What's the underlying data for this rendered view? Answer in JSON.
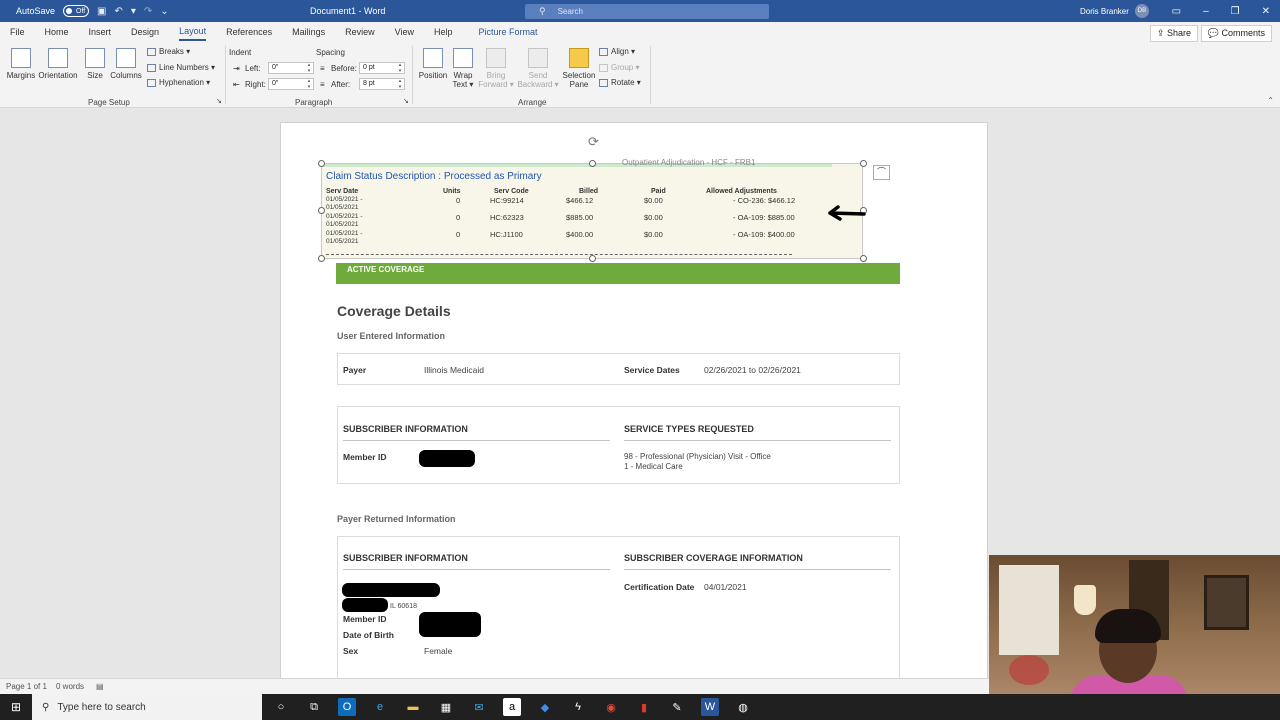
{
  "titlebar": {
    "autosave_label": "AutoSave",
    "autosave_state": "Off",
    "doc_title": "Document1 - Word",
    "search_placeholder": "Search",
    "user_name": "Doris Branker",
    "user_initials": "DB"
  },
  "tabs": [
    "File",
    "Home",
    "Insert",
    "Design",
    "Layout",
    "References",
    "Mailings",
    "Review",
    "View",
    "Help"
  ],
  "active_tab": "Layout",
  "contextual_tab": "Picture Format",
  "share_label": "Share",
  "comments_label": "Comments",
  "ribbon": {
    "page_setup": {
      "margins": "Margins",
      "orientation": "Orientation",
      "size": "Size",
      "columns": "Columns",
      "breaks": "Breaks",
      "line_numbers": "Line Numbers",
      "hyphenation": "Hyphenation",
      "group_label": "Page Setup"
    },
    "paragraph": {
      "indent_label": "Indent",
      "left_label": "Left:",
      "left_value": "0\"",
      "right_label": "Right:",
      "right_value": "0\"",
      "spacing_label": "Spacing",
      "before_label": "Before:",
      "before_value": "0 pt",
      "after_label": "After:",
      "after_value": "8 pt",
      "group_label": "Paragraph"
    },
    "arrange": {
      "position": "Position",
      "wrap_text_1": "Wrap",
      "wrap_text_2": "Text",
      "bring_forward_1": "Bring",
      "bring_forward_2": "Forward",
      "send_backward_1": "Send",
      "send_backward_2": "Backward",
      "selection_pane_1": "Selection",
      "selection_pane_2": "Pane",
      "align": "Align",
      "group": "Group",
      "rotate": "Rotate",
      "group_label": "Arrange"
    }
  },
  "claim_image": {
    "cut_text": "Outpatient Adjudication - HCF - FRB1",
    "title": "Claim Status Description : Processed as Primary",
    "headers": [
      "Serv Date",
      "Units",
      "Serv Code",
      "Billed",
      "Paid",
      "Allowed Adjustments"
    ],
    "rows": [
      {
        "date1": "01/05/2021 -",
        "date2": "01/05/2021",
        "units": "0",
        "code": "HC:99214",
        "billed": "$466.12",
        "paid": "$0.00",
        "adj": "- CO-236: $466.12"
      },
      {
        "date1": "01/05/2021 -",
        "date2": "01/05/2021",
        "units": "0",
        "code": "HC:62323",
        "billed": "$885.00",
        "paid": "$0.00",
        "adj": "- OA-109: $885.00"
      },
      {
        "date1": "01/05/2021 -",
        "date2": "01/05/2021",
        "units": "0",
        "code": "HC:J1100",
        "billed": "$400.00",
        "paid": "$0.00",
        "adj": "- OA-109: $400.00"
      }
    ]
  },
  "document": {
    "active_coverage": "ACTIVE COVERAGE",
    "coverage_details": "Coverage Details",
    "user_entered": "User Entered Information",
    "payer_label": "Payer",
    "payer_value": "Illinois Medicaid",
    "service_dates_label": "Service Dates",
    "service_dates_value": "02/26/2021 to 02/26/2021",
    "subscriber_info": "SUBSCRIBER INFORMATION",
    "service_types": "SERVICE TYPES REQUESTED",
    "member_id_label": "Member ID",
    "service_type_1": "98 - Professional (Physician) Visit - Office",
    "service_type_2": "1 - Medical Care",
    "payer_returned": "Payer Returned Information",
    "subscriber_info_2": "SUBSCRIBER INFORMATION",
    "subscriber_coverage": "SUBSCRIBER COVERAGE INFORMATION",
    "address_partial": "IL 60618",
    "member_id_label_2": "Member ID",
    "dob_label": "Date of Birth",
    "sex_label": "Sex",
    "sex_value": "Female",
    "cert_date_label": "Certification Date",
    "cert_date_value": "04/01/2021"
  },
  "statusbar": {
    "page": "Page 1 of 1",
    "words": "0 words"
  },
  "taskbar": {
    "search_placeholder": "Type here to search"
  },
  "colors": {
    "word_blue": "#2b579a",
    "active_coverage_green": "#6faa3c",
    "claim_title_blue": "#1f56b8"
  }
}
